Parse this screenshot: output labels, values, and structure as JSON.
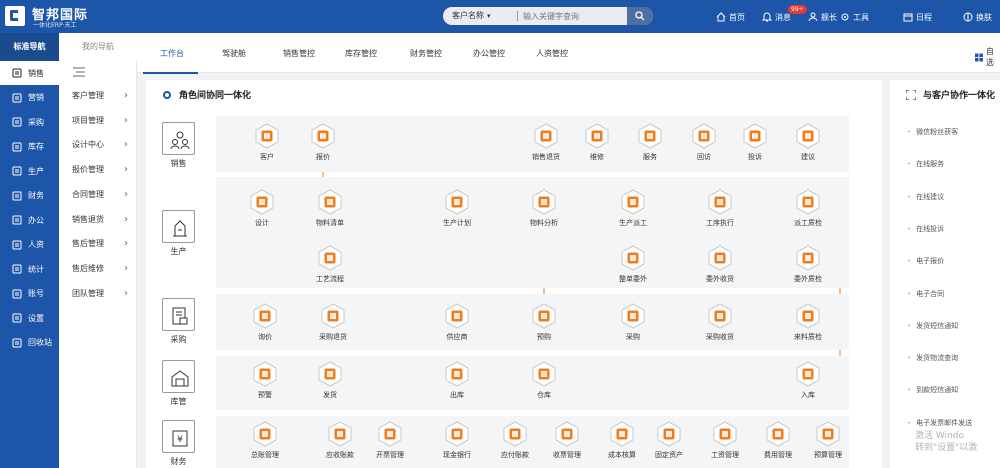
{
  "app": {
    "brand": "智邦国际",
    "brand_sub": "一体化ERP·天工"
  },
  "search": {
    "select": "客户名称",
    "placeholder": "输入关键字查询"
  },
  "topnav": [
    {
      "icon": "home-icon",
      "label": "首页"
    },
    {
      "icon": "bell-icon",
      "label": "消息"
    },
    {
      "icon": "user-icon",
      "label": "舰长"
    },
    {
      "icon": "tools-icon",
      "label": "工具"
    },
    {
      "icon": "calendar-icon",
      "label": "日程"
    },
    {
      "icon": "switch-icon",
      "label": "换肤"
    }
  ],
  "badge": "99+",
  "nav_tabs": {
    "standard": "标准导航",
    "mine": "我的导航"
  },
  "sidebar": [
    {
      "label": "销售",
      "icon": "sales-icon"
    },
    {
      "label": "营销",
      "icon": "chart-icon"
    },
    {
      "label": "采购",
      "icon": "purchase-icon"
    },
    {
      "label": "库存",
      "icon": "inventory-icon"
    },
    {
      "label": "生产",
      "icon": "truck-icon"
    },
    {
      "label": "财务",
      "icon": "yen-icon"
    },
    {
      "label": "办公",
      "icon": "briefcase-icon"
    },
    {
      "label": "人资",
      "icon": "people-icon"
    },
    {
      "label": "统计",
      "icon": "clock-icon"
    },
    {
      "label": "账号",
      "icon": "account-icon"
    },
    {
      "label": "设置",
      "icon": "settings-icon"
    },
    {
      "label": "回收站",
      "icon": "trash-icon"
    }
  ],
  "submenu": [
    "客户管理",
    "项目管理",
    "设计中心",
    "报价管理",
    "合同管理",
    "销售退货",
    "售后管理",
    "售后维修",
    "团队管理"
  ],
  "tabs": [
    "工作台",
    "驾驶舱",
    "销售管控",
    "库存管控",
    "财务管控",
    "办公管控",
    "人资管控"
  ],
  "right_top": "自选",
  "main": {
    "title": "角色间协同一体化"
  },
  "categories": [
    "销售",
    "生产",
    "采购",
    "库管",
    "财务"
  ],
  "rows": {
    "sales": [
      "客户",
      "报价",
      "销售退货",
      "维修",
      "服务",
      "回访",
      "投诉",
      "建议"
    ],
    "production": [
      "设计",
      "物料清单",
      "生产计划",
      "物料分析",
      "生产派工",
      "工序执行",
      "派工质检",
      "工艺流程",
      "整单委外",
      "委外收货",
      "委外质检"
    ],
    "purchase": [
      "询价",
      "采购退货",
      "供应商",
      "预购",
      "采购",
      "采购收货",
      "来料质检"
    ],
    "warehouse": [
      "预警",
      "发货",
      "出库",
      "仓库",
      "入库"
    ],
    "finance": [
      "总账管理",
      "应收账款",
      "开票管理",
      "现金银行",
      "应付账款",
      "收票管理",
      "成本核算",
      "固定资产",
      "工资管理",
      "费用管理",
      "预算管理"
    ]
  },
  "right": {
    "title": "与客户协作一体化",
    "items": [
      "微信粉丝获客",
      "在线服务",
      "在线建议",
      "在线投诉",
      "电子报价",
      "电子合同",
      "发货短信通知",
      "发货物流查询",
      "到款短信通知",
      "电子发票邮件发送"
    ]
  },
  "watermark": [
    "激活 Windo",
    "转到\"设置\"以激"
  ],
  "colors": {
    "primary": "#1d55a8",
    "accent": "#f07c1e",
    "badge": "#e53935"
  }
}
